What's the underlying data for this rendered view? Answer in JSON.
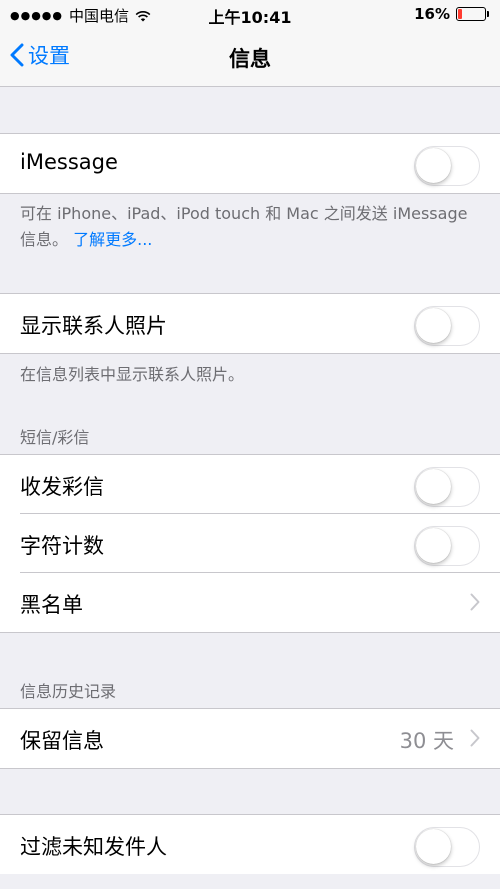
{
  "status_bar": {
    "signal": "●●●●●",
    "carrier": "中国电信",
    "time": "上午10:41",
    "battery_percent": "16%",
    "battery_level": 0.16,
    "battery_color": "#ff3b30"
  },
  "nav": {
    "back_label": "设置",
    "title": "信息"
  },
  "imessage": {
    "label": "iMessage",
    "enabled": false,
    "footnote": "可在 iPhone、iPad、iPod touch 和 Mac 之间发送 iMessage 信息。",
    "learn_more": "了解更多..."
  },
  "contact_photos": {
    "label": "显示联系人照片",
    "enabled": false,
    "footnote": "在信息列表中显示联系人照片。"
  },
  "sms_section": {
    "header": "短信/彩信",
    "mms_label": "收发彩信",
    "mms_enabled": false,
    "char_count_label": "字符计数",
    "char_count_enabled": false,
    "blocked_label": "黑名单"
  },
  "history_section": {
    "header": "信息历史记录",
    "keep_label": "保留信息",
    "keep_value": "30 天"
  },
  "filter": {
    "label": "过滤未知发件人",
    "enabled": false
  },
  "colors": {
    "accent": "#007aff",
    "background": "#efeff4",
    "separator": "#c8c7cc"
  }
}
